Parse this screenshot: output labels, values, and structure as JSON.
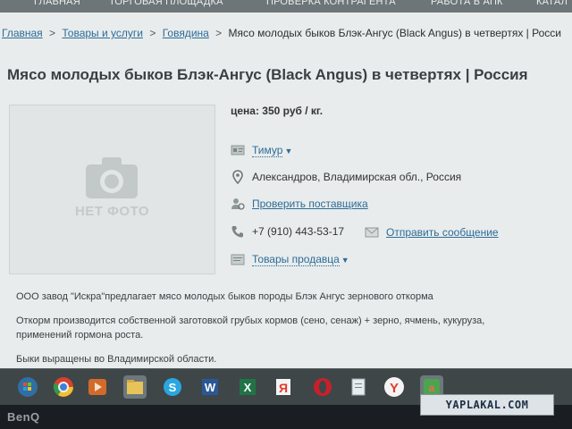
{
  "topnav": {
    "items": [
      "Главная",
      "Торговая площадка",
      "Проверка контрагента",
      "Работа в АПК",
      "Катал"
    ]
  },
  "breadcrumb": {
    "items": [
      "Главная",
      "Товары и услуги",
      "Говядина"
    ],
    "current": "Мясо молодых быков Блэк-Ангус (Black Angus) в четвертях | Росси",
    "separator": ">"
  },
  "product": {
    "title": "Мясо молодых быков Блэк-Ангус (Black Angus) в четвертях | Россия",
    "no_photo_label": "НЕТ ФОТО",
    "price": "цена: 350 руб / кг.",
    "seller_name": "Тимур",
    "location": "Александров, Владимирская обл., Россия",
    "verify_supplier": "Проверить поставщика",
    "phone": "+7 (910) 443-53-17",
    "send_message": "Отправить сообщение",
    "seller_goods": "Товары продавца"
  },
  "description": {
    "line1": "ООО завод \"Искра\"предлагает мясо молодых быков породы Блэк Ангус зернового откорма",
    "line2": "Откорм производится собственной заготовкой грубых кормов (сено, сенаж) + зерно, ячмень, кукуруза,",
    "line3": "применений гормона роста.",
    "line4": "Быки выращены во Владимирской области."
  },
  "taskbar": {
    "icons": [
      "windows-start",
      "chrome",
      "media-player",
      "file-explorer",
      "skype",
      "word",
      "excel",
      "yandex",
      "opera",
      "notepad",
      "yandex-browser",
      "app"
    ]
  },
  "watermark": "YAPLAKAL.COM",
  "monitor_brand": "BenQ",
  "colors": {
    "link": "#2c6c9a",
    "page_bg": "#e9ecec",
    "taskbar_bg": "#3f4648"
  }
}
